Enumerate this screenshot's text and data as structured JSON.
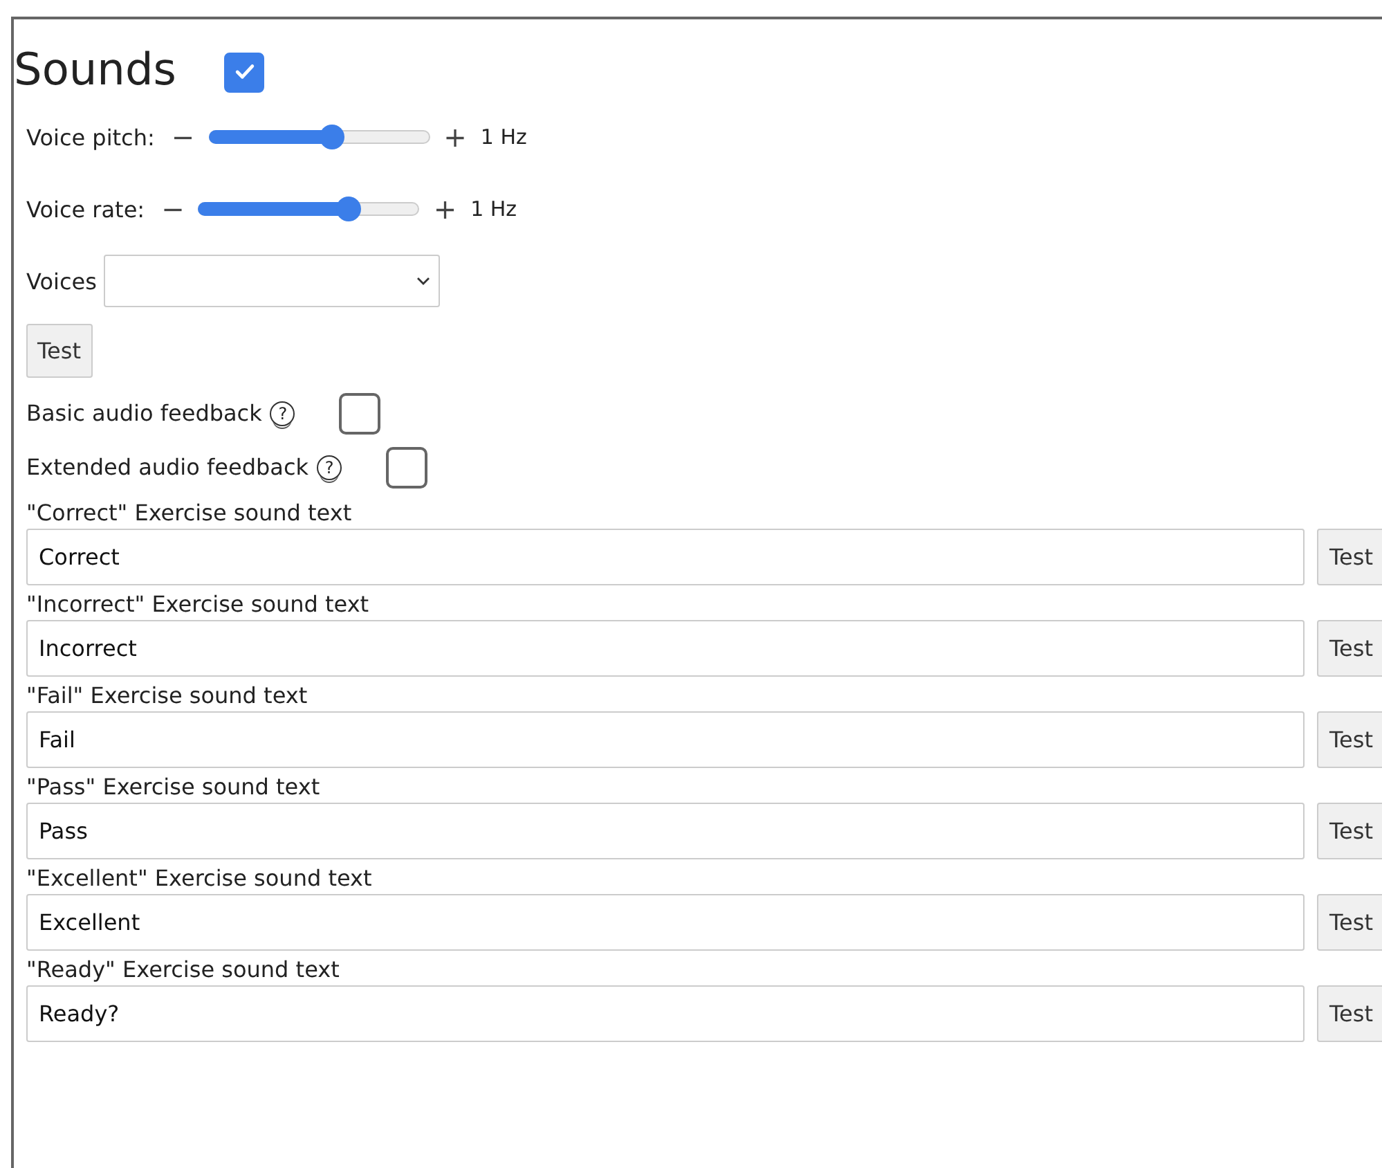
{
  "title": "Sounds",
  "enabled": true,
  "sliders": [
    {
      "label": "Voice pitch:",
      "minus": "−",
      "plus": "+",
      "level": 0.56,
      "reading": "1 Hz"
    },
    {
      "label": "Voice rate:",
      "minus": "−",
      "plus": "+",
      "level": 0.68,
      "reading": "1 Hz"
    }
  ],
  "voices": {
    "label": "Voices"
  },
  "test_button": "Test",
  "feedback": [
    {
      "label": "Basic audio feedback",
      "help": "?",
      "checked": false
    },
    {
      "label": "Extended audio feedback",
      "help": "?",
      "checked": false
    }
  ],
  "sound_texts": [
    {
      "label": "\"Correct\" Exercise sound text",
      "value": "Correct",
      "button": "Test"
    },
    {
      "label": "\"Incorrect\" Exercise sound text",
      "value": "Incorrect",
      "button": "Test"
    },
    {
      "label": "\"Fail\" Exercise sound text",
      "value": "Fail",
      "button": "Test"
    },
    {
      "label": "\"Pass\" Exercise sound text",
      "value": "Pass",
      "button": "Test"
    },
    {
      "label": "\"Excellent\" Exercise sound text",
      "value": "Excellent",
      "button": "Test"
    },
    {
      "label": "\"Ready\" Exercise sound text",
      "value": "Ready?",
      "button": "Test"
    }
  ]
}
